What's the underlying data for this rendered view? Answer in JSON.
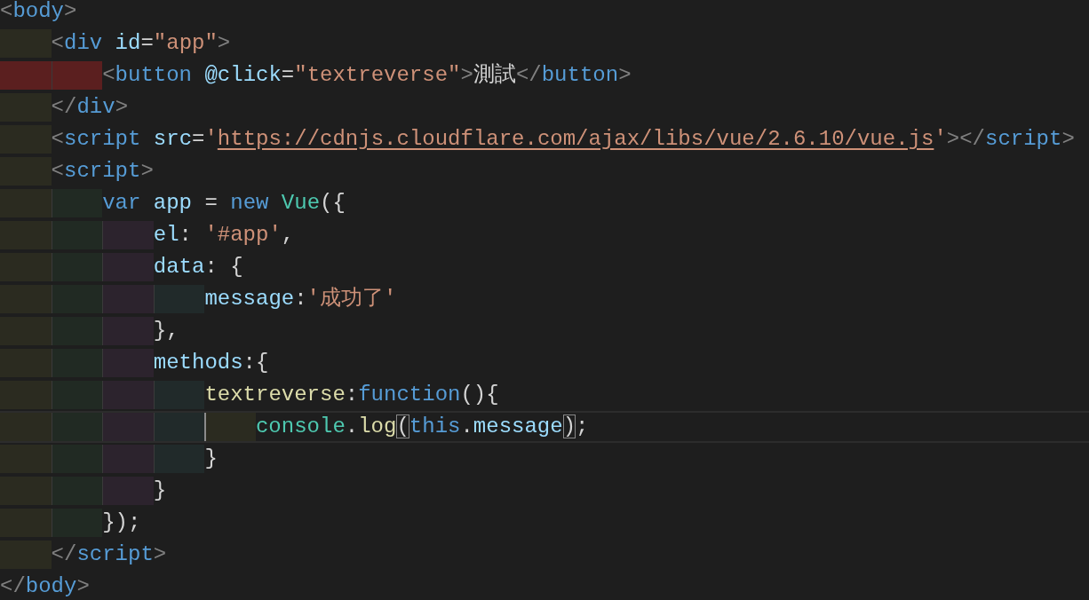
{
  "editor": {
    "lines": [
      {
        "tokens": [
          {
            "kind": "punct",
            "text": "<"
          },
          {
            "kind": "tag",
            "text": "body"
          },
          {
            "kind": "punct",
            "text": ">"
          }
        ],
        "children": [
          {
            "tokens": [
              {
                "kind": "punct",
                "text": "<"
              },
              {
                "kind": "tag",
                "text": "div"
              },
              {
                "kind": "attr",
                "text": " id"
              },
              {
                "kind": "text",
                "text": "="
              },
              {
                "kind": "string",
                "text": "\"app\""
              },
              {
                "kind": "punct",
                "text": ">"
              }
            ],
            "children": [
              {
                "error": true,
                "tokens": [
                  {
                    "kind": "punct",
                    "text": "<"
                  },
                  {
                    "kind": "tag",
                    "text": "button"
                  },
                  {
                    "kind": "attr",
                    "text": " @click"
                  },
                  {
                    "kind": "text",
                    "text": "="
                  },
                  {
                    "kind": "string",
                    "text": "\"textreverse\""
                  },
                  {
                    "kind": "punct",
                    "text": ">"
                  },
                  {
                    "kind": "text",
                    "text": "測試"
                  },
                  {
                    "kind": "punct",
                    "text": "</"
                  },
                  {
                    "kind": "tag",
                    "text": "button"
                  },
                  {
                    "kind": "punct",
                    "text": ">"
                  }
                ]
              }
            ]
          },
          {
            "tokens": [
              {
                "kind": "punct",
                "text": "</"
              },
              {
                "kind": "tag",
                "text": "div"
              },
              {
                "kind": "punct",
                "text": ">"
              }
            ]
          },
          {
            "tokens": [
              {
                "kind": "punct",
                "text": "<"
              },
              {
                "kind": "tag",
                "text": "script"
              },
              {
                "kind": "attr",
                "text": " src"
              },
              {
                "kind": "text",
                "text": "="
              },
              {
                "kind": "string",
                "text": "'"
              },
              {
                "kind": "link",
                "text": "https://cdnjs.cloudflare.com/ajax/libs/vue/2.6.10/vue.js"
              },
              {
                "kind": "string",
                "text": "'"
              },
              {
                "kind": "punct",
                "text": "></"
              },
              {
                "kind": "tag",
                "text": "script"
              },
              {
                "kind": "punct",
                "text": ">"
              }
            ]
          },
          {
            "tokens": [
              {
                "kind": "punct",
                "text": "<"
              },
              {
                "kind": "tag",
                "text": "script"
              },
              {
                "kind": "punct",
                "text": ">"
              }
            ],
            "children": [
              {
                "tokens": [
                  {
                    "kind": "keyword",
                    "text": "var"
                  },
                  {
                    "kind": "prop",
                    "text": " app"
                  },
                  {
                    "kind": "text",
                    "text": " = "
                  },
                  {
                    "kind": "keyword",
                    "text": "new"
                  },
                  {
                    "kind": "class",
                    "text": " Vue"
                  },
                  {
                    "kind": "text",
                    "text": "({"
                  }
                ],
                "children": [
                  {
                    "tokens": [
                      {
                        "kind": "prop",
                        "text": "el"
                      },
                      {
                        "kind": "text",
                        "text": ": "
                      },
                      {
                        "kind": "string",
                        "text": "'#app'"
                      },
                      {
                        "kind": "text",
                        "text": ","
                      }
                    ]
                  },
                  {
                    "tokens": [
                      {
                        "kind": "prop",
                        "text": "data"
                      },
                      {
                        "kind": "text",
                        "text": ": {"
                      }
                    ],
                    "children": [
                      {
                        "tokens": [
                          {
                            "kind": "prop",
                            "text": "message"
                          },
                          {
                            "kind": "text",
                            "text": ":"
                          },
                          {
                            "kind": "string",
                            "text": "'成功了'"
                          }
                        ]
                      }
                    ]
                  },
                  {
                    "tokens": [
                      {
                        "kind": "text",
                        "text": "},"
                      }
                    ]
                  },
                  {
                    "tokens": [
                      {
                        "kind": "prop",
                        "text": "methods"
                      },
                      {
                        "kind": "text",
                        "text": ":{"
                      }
                    ],
                    "children": [
                      {
                        "tokens": [
                          {
                            "kind": "func",
                            "text": "textreverse"
                          },
                          {
                            "kind": "text",
                            "text": ":"
                          },
                          {
                            "kind": "keyword",
                            "text": "function"
                          },
                          {
                            "kind": "text",
                            "text": "(){"
                          }
                        ],
                        "children": [
                          {
                            "current": true,
                            "tokens": [
                              {
                                "kind": "class",
                                "text": "console"
                              },
                              {
                                "kind": "text",
                                "text": "."
                              },
                              {
                                "kind": "func",
                                "text": "log"
                              },
                              {
                                "kind": "text",
                                "text": "(",
                                "matched": true
                              },
                              {
                                "kind": "keyword",
                                "text": "this"
                              },
                              {
                                "kind": "text",
                                "text": "."
                              },
                              {
                                "kind": "prop",
                                "text": "message"
                              },
                              {
                                "kind": "text",
                                "text": ")",
                                "matched": true
                              },
                              {
                                "kind": "text",
                                "text": ";"
                              }
                            ]
                          }
                        ]
                      },
                      {
                        "tokens": [
                          {
                            "kind": "text",
                            "text": "}"
                          }
                        ]
                      }
                    ]
                  },
                  {
                    "tokens": [
                      {
                        "kind": "text",
                        "text": "}"
                      }
                    ]
                  }
                ]
              },
              {
                "tokens": [
                  {
                    "kind": "text",
                    "text": "});"
                  }
                ]
              }
            ]
          },
          {
            "tokens": [
              {
                "kind": "punct",
                "text": "</"
              },
              {
                "kind": "tag",
                "text": "script"
              },
              {
                "kind": "punct",
                "text": ">"
              }
            ]
          }
        ]
      },
      {
        "tokens": [
          {
            "kind": "punct",
            "text": "</"
          },
          {
            "kind": "tag",
            "text": "body"
          },
          {
            "kind": "punct",
            "text": ">"
          }
        ]
      }
    ]
  }
}
